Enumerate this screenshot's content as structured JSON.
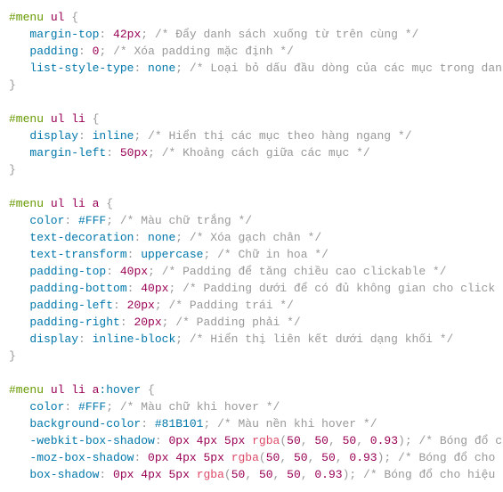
{
  "rules": [
    {
      "selector": [
        {
          "t": "sel",
          "v": "#menu "
        },
        {
          "t": "tag",
          "v": "ul"
        }
      ],
      "decls": [
        {
          "prop": "margin-top",
          "val": [
            {
              "t": "num",
              "v": "42"
            },
            {
              "t": "unit",
              "v": "px"
            }
          ],
          "comment": "/* Đẩy danh sách xuống từ trên cùng */"
        },
        {
          "prop": "padding",
          "val": [
            {
              "t": "num",
              "v": "0"
            }
          ],
          "comment": "/* Xóa padding mặc định */"
        },
        {
          "prop": "list-style-type",
          "val": [
            {
              "t": "val",
              "v": "none"
            }
          ],
          "comment": "/* Loại bỏ dấu đầu dòng của các mục trong danh sách */"
        }
      ]
    },
    {
      "selector": [
        {
          "t": "sel",
          "v": "#menu "
        },
        {
          "t": "tag",
          "v": "ul li"
        }
      ],
      "decls": [
        {
          "prop": "display",
          "val": [
            {
              "t": "val",
              "v": "inline"
            }
          ],
          "comment": "/* Hiển thị các mục theo hàng ngang */"
        },
        {
          "prop": "margin-left",
          "val": [
            {
              "t": "num",
              "v": "50"
            },
            {
              "t": "unit",
              "v": "px"
            }
          ],
          "comment": "/* Khoảng cách giữa các mục */"
        }
      ]
    },
    {
      "selector": [
        {
          "t": "sel",
          "v": "#menu "
        },
        {
          "t": "tag",
          "v": "ul li a"
        }
      ],
      "decls": [
        {
          "prop": "color",
          "val": [
            {
              "t": "hex",
              "v": "#FFF"
            }
          ],
          "comment": "/* Màu chữ trắng */"
        },
        {
          "prop": "text-decoration",
          "val": [
            {
              "t": "val",
              "v": "none"
            }
          ],
          "comment": "/* Xóa gạch chân */"
        },
        {
          "prop": "text-transform",
          "val": [
            {
              "t": "val",
              "v": "uppercase"
            }
          ],
          "comment": "/* Chữ in hoa */"
        },
        {
          "prop": "padding-top",
          "val": [
            {
              "t": "num",
              "v": "40"
            },
            {
              "t": "unit",
              "v": "px"
            }
          ],
          "comment": "/* Padding để tăng chiều cao clickable */"
        },
        {
          "prop": "padding-bottom",
          "val": [
            {
              "t": "num",
              "v": "40"
            },
            {
              "t": "unit",
              "v": "px"
            }
          ],
          "comment": "/* Padding dưới để có đủ không gian cho click */"
        },
        {
          "prop": "padding-left",
          "val": [
            {
              "t": "num",
              "v": "20"
            },
            {
              "t": "unit",
              "v": "px"
            }
          ],
          "comment": "/* Padding trái */"
        },
        {
          "prop": "padding-right",
          "val": [
            {
              "t": "num",
              "v": "20"
            },
            {
              "t": "unit",
              "v": "px"
            }
          ],
          "comment": "/* Padding phải */"
        },
        {
          "prop": "display",
          "val": [
            {
              "t": "val",
              "v": "inline-block"
            }
          ],
          "comment": "/* Hiển thị liên kết dưới dạng khối */"
        }
      ]
    },
    {
      "selector": [
        {
          "t": "sel",
          "v": "#menu "
        },
        {
          "t": "tag",
          "v": "ul li a"
        },
        {
          "t": "pc",
          "v": ":hover"
        }
      ],
      "decls": [
        {
          "prop": "color",
          "val": [
            {
              "t": "hex",
              "v": "#FFF"
            }
          ],
          "comment": "/* Màu chữ khi hover */"
        },
        {
          "prop": "background-color",
          "val": [
            {
              "t": "hex",
              "v": "#81B101"
            }
          ],
          "comment": "/* Màu nền khi hover */"
        },
        {
          "prop": "-webkit-box-shadow",
          "val": [
            {
              "t": "num",
              "v": "0"
            },
            {
              "t": "unit",
              "v": "px "
            },
            {
              "t": "num",
              "v": "4"
            },
            {
              "t": "unit",
              "v": "px "
            },
            {
              "t": "num",
              "v": "5"
            },
            {
              "t": "unit",
              "v": "px "
            },
            {
              "t": "fn",
              "v": "rgba"
            },
            {
              "t": "punc",
              "v": "("
            },
            {
              "t": "num",
              "v": "50"
            },
            {
              "t": "punc",
              "v": ", "
            },
            {
              "t": "num",
              "v": "50"
            },
            {
              "t": "punc",
              "v": ", "
            },
            {
              "t": "num",
              "v": "50"
            },
            {
              "t": "punc",
              "v": ", "
            },
            {
              "t": "num",
              "v": "0.93"
            },
            {
              "t": "punc",
              "v": ")"
            }
          ],
          "comment": "/* Bóng đổ cho hiệu ứng hover */"
        },
        {
          "prop": "-moz-box-shadow",
          "val": [
            {
              "t": "num",
              "v": "0"
            },
            {
              "t": "unit",
              "v": "px "
            },
            {
              "t": "num",
              "v": "4"
            },
            {
              "t": "unit",
              "v": "px "
            },
            {
              "t": "num",
              "v": "5"
            },
            {
              "t": "unit",
              "v": "px "
            },
            {
              "t": "fn",
              "v": "rgba"
            },
            {
              "t": "punc",
              "v": "("
            },
            {
              "t": "num",
              "v": "50"
            },
            {
              "t": "punc",
              "v": ", "
            },
            {
              "t": "num",
              "v": "50"
            },
            {
              "t": "punc",
              "v": ", "
            },
            {
              "t": "num",
              "v": "50"
            },
            {
              "t": "punc",
              "v": ", "
            },
            {
              "t": "num",
              "v": "0.93"
            },
            {
              "t": "punc",
              "v": ")"
            }
          ],
          "comment": "/* Bóng đổ cho hiệu ứng hover */"
        },
        {
          "prop": "box-shadow",
          "val": [
            {
              "t": "num",
              "v": "0"
            },
            {
              "t": "unit",
              "v": "px "
            },
            {
              "t": "num",
              "v": "4"
            },
            {
              "t": "unit",
              "v": "px "
            },
            {
              "t": "num",
              "v": "5"
            },
            {
              "t": "unit",
              "v": "px "
            },
            {
              "t": "fn",
              "v": "rgba"
            },
            {
              "t": "punc",
              "v": "("
            },
            {
              "t": "num",
              "v": "50"
            },
            {
              "t": "punc",
              "v": ", "
            },
            {
              "t": "num",
              "v": "50"
            },
            {
              "t": "punc",
              "v": ", "
            },
            {
              "t": "num",
              "v": "50"
            },
            {
              "t": "punc",
              "v": ", "
            },
            {
              "t": "num",
              "v": "0.93"
            },
            {
              "t": "punc",
              "v": ")"
            }
          ],
          "comment": "/* Bóng đổ cho hiệu ứng hover */"
        }
      ],
      "open": true
    }
  ]
}
